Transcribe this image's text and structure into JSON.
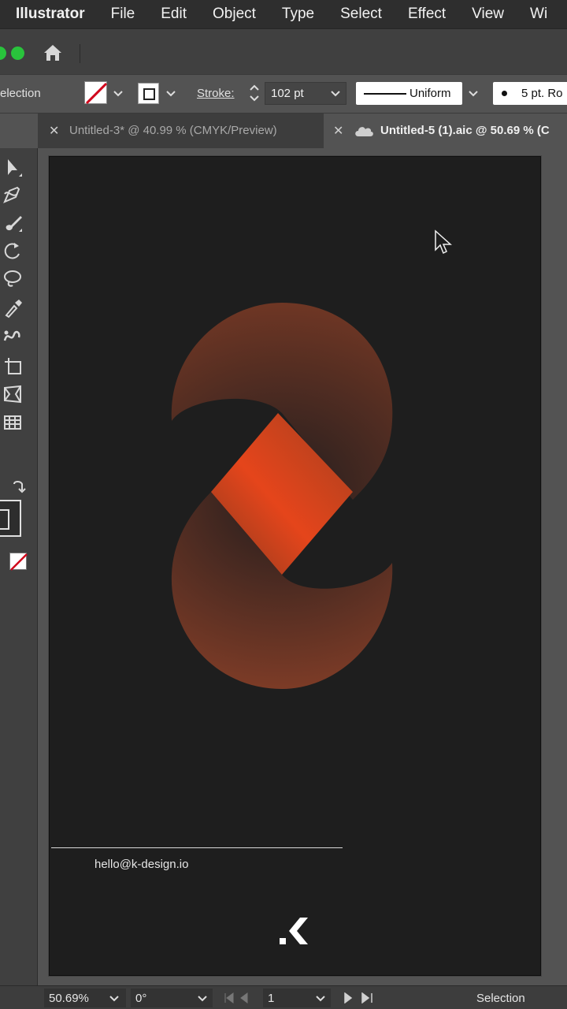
{
  "menubar": {
    "app_name": "Illustrator",
    "items": [
      "File",
      "Edit",
      "Object",
      "Type",
      "Select",
      "Effect",
      "View",
      "Wi"
    ]
  },
  "controlbar": {
    "tool_label": "election",
    "stroke_label": "Stroke:",
    "stroke_value": "102 pt",
    "profile_label": "Uniform",
    "brush_label": "5 pt. Ro"
  },
  "tabs": [
    {
      "title": "Untitled-3* @ 40.99 % (CMYK/Preview)",
      "active": false
    },
    {
      "title": "Untitled-5 (1).aic @ 50.69 % (C",
      "active": true
    }
  ],
  "artboard": {
    "email": "hello@k-design.io",
    "background": "#1e1e1e",
    "accent": "#e5451b"
  },
  "statusbar": {
    "zoom": "50.69%",
    "rotation": "0°",
    "artboard_number": "1",
    "current_tool": "Selection"
  },
  "icons": {
    "toolbar": [
      "selection-tool-icon",
      "pen-tool-icon",
      "paintbrush-tool-icon",
      "rotate-tool-icon",
      "lasso-tool-icon",
      "eyedropper-tool-icon",
      "puppet-warp-tool-icon",
      "artboard-tool-icon",
      "perspective-tool-icon",
      "graph-tool-icon"
    ]
  }
}
